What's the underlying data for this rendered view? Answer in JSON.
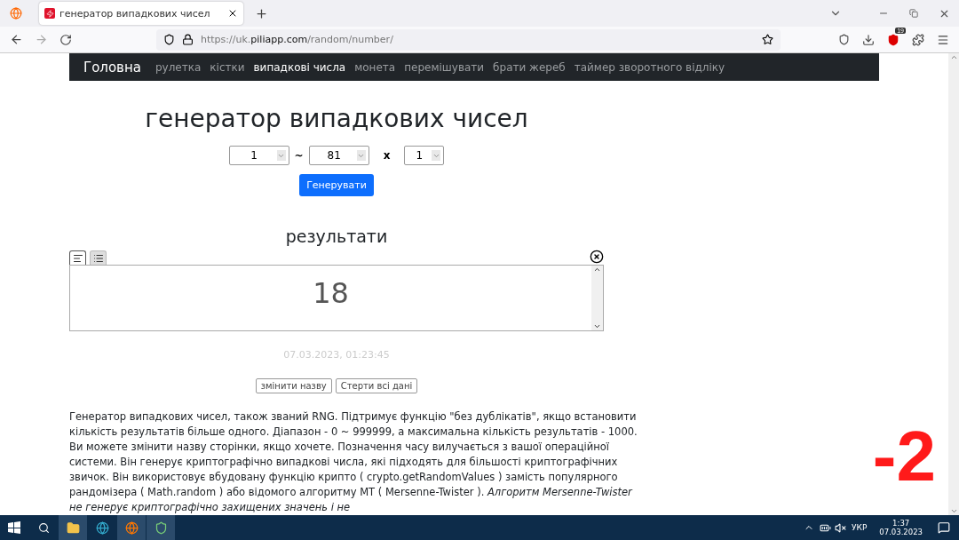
{
  "browser": {
    "tab_title": "генератор випадкових чисел",
    "url": "https://uk.**piliapp.com**/random/number/",
    "extension_badge": "19"
  },
  "navbar": {
    "brand": "Головна",
    "items": [
      {
        "label": "рулетка",
        "selected": false
      },
      {
        "label": "кістки",
        "selected": false
      },
      {
        "label": "випадкові числа",
        "selected": true
      },
      {
        "label": "монета",
        "selected": false
      },
      {
        "label": "перемішувати",
        "selected": false
      },
      {
        "label": "брати жереб",
        "selected": false
      },
      {
        "label": "таймер зворотного відліку",
        "selected": false
      }
    ]
  },
  "title": "генератор випадкових чисел",
  "form": {
    "min": "1",
    "separator": "~",
    "max": "81",
    "times": "x",
    "count": "1",
    "button": "Генерувати"
  },
  "results": {
    "heading": "результати",
    "views": [
      {
        "kind": "text",
        "selected": true
      },
      {
        "kind": "list",
        "selected": false
      }
    ],
    "value": "18",
    "timestamp": "07.03.2023, 01:23:45",
    "buttons": [
      "змінити назву",
      "Стерти всі дані"
    ]
  },
  "description": "Генератор випадкових чисел, також званий RNG. Підтримує функцію \"без дублікатів\", якщо встановити кількість результатів більше одного. Діапазон - 0 ~ 999999, а максимальна кількість результатів - 1000. Ви можете змінити назву сторінки, якщо хочете. Позначення часу вилучається з вашої операційної системи. Він генерує криптографічно випадкові числа, які підходять для більшості криптографічних звичок. Він використовує вбудовану функцію крипто ( crypto.getRandomValues ) замість популярного рандомізера ( Math.random ) або відомого алгоритму MT ( Mersenne-Twister ). *Алгоритм Mersenne-Twister не генерує криптографічно захищених значень і не*",
  "overlay_label": "-2",
  "taskbar": {
    "language": "УКР",
    "time": "1:37",
    "date": "07.03.2023"
  }
}
